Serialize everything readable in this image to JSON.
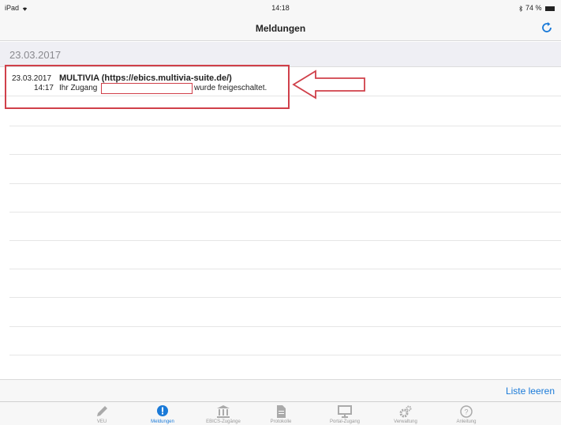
{
  "status": {
    "device": "iPad",
    "wifi_icon": "wifi-icon",
    "time": "14:18",
    "bluetooth_icon": "bluetooth-icon",
    "battery": "74 %"
  },
  "nav": {
    "title": "Meldungen",
    "refresh_icon": "refresh-icon"
  },
  "section": {
    "date": "23.03.2017"
  },
  "message": {
    "date": "23.03.2017",
    "time": "14:17",
    "title": "MULTIVIA (https://ebics.multivia-suite.de/)",
    "text_before": "Ihr Zugang",
    "text_after": "wurde freigeschaltet."
  },
  "footer": {
    "clear_label": "Liste leeren"
  },
  "tabs": [
    {
      "label": "VEU",
      "icon": "pencil-icon",
      "active": false
    },
    {
      "label": "Meldungen",
      "icon": "alert-bubble-icon",
      "active": true
    },
    {
      "label": "EBICS-Zugänge",
      "icon": "bank-icon",
      "active": false
    },
    {
      "label": "Protokolle",
      "icon": "document-icon",
      "active": false
    },
    {
      "label": "Portal-Zugang",
      "icon": "monitor-icon",
      "active": false
    },
    {
      "label": "Verwaltung",
      "icon": "gears-icon",
      "active": false
    },
    {
      "label": "Anleitung",
      "icon": "help-icon",
      "active": false
    }
  ],
  "colors": {
    "accent": "#1a7ad8",
    "annotation": "#d0404a"
  }
}
